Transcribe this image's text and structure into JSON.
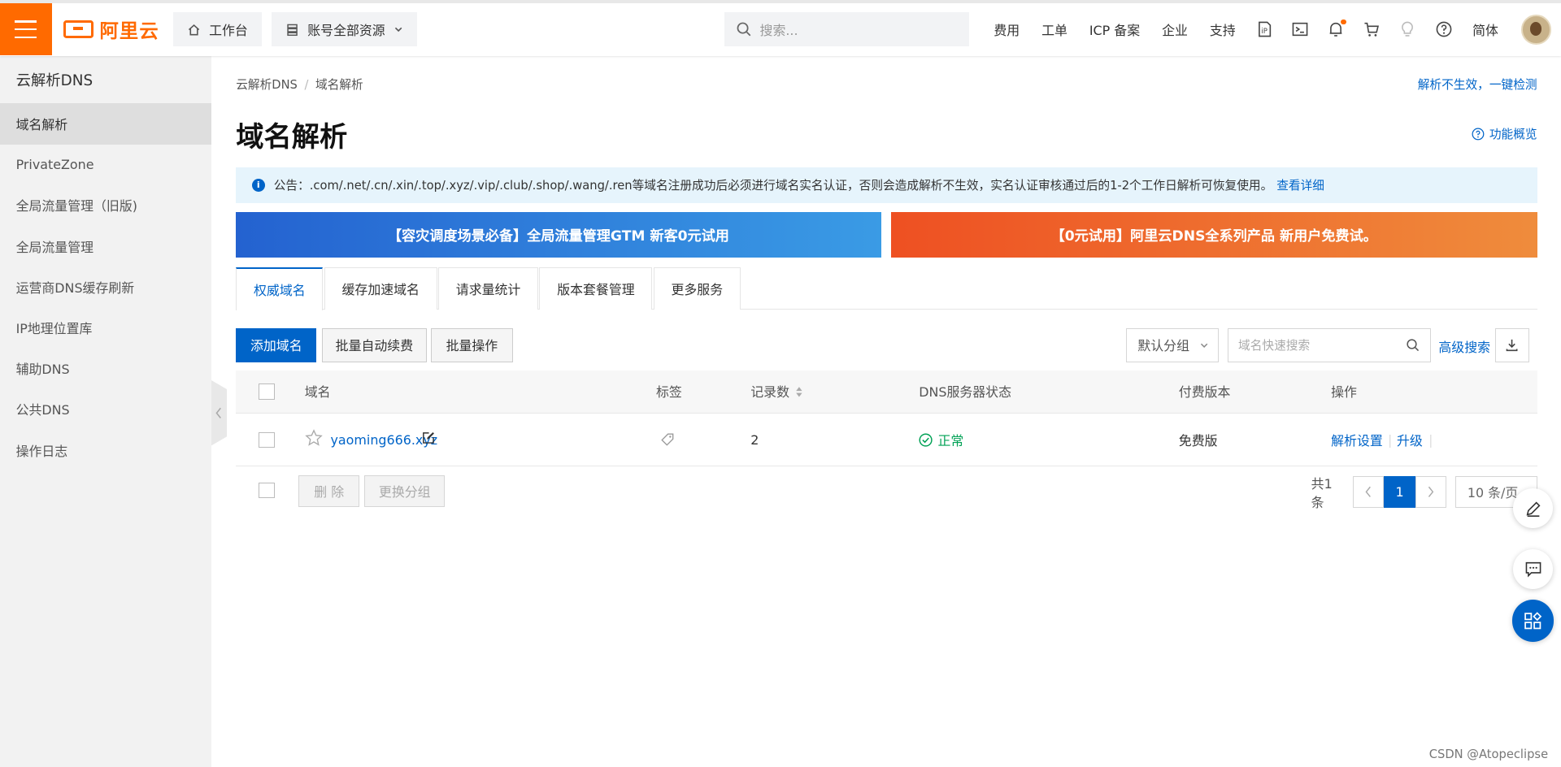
{
  "header": {
    "logo_text": "阿里云",
    "workbench_label": "工作台",
    "resource_label": "账号全部资源",
    "search_placeholder": "搜索...",
    "links": [
      "费用",
      "工单",
      "ICP 备案",
      "企业",
      "支持"
    ],
    "lang_label": "简体"
  },
  "sidebar": {
    "title": "云解析DNS",
    "items": [
      "域名解析",
      "PrivateZone",
      "全局流量管理（旧版)",
      "全局流量管理",
      "运营商DNS缓存刷新",
      "IP地理位置库",
      "辅助DNS",
      "公共DNS",
      "操作日志"
    ]
  },
  "breadcrumb": {
    "root": "云解析DNS",
    "sep": "/",
    "current": "域名解析"
  },
  "check_link": "解析不生效，一键检测",
  "page_title": "域名解析",
  "overview_label": "功能概览",
  "notice": {
    "text": "公告：.com/.net/.cn/.xin/.top/.xyz/.vip/.club/.shop/.wang/.ren等域名注册成功后必须进行域名实名认证，否则会造成解析不生效，实名认证审核通过后的1-2个工作日解析可恢复使用。",
    "link": "查看详细"
  },
  "banners": {
    "left": "【容灾调度场景必备】全局流量管理GTM 新客0元试用",
    "right": "【0元试用】阿里云DNS全系列产品 新用户免费试。"
  },
  "tabs": [
    "权威域名",
    "缓存加速域名",
    "请求量统计",
    "版本套餐管理",
    "更多服务"
  ],
  "toolbar": {
    "add": "添加域名",
    "auto_renew": "批量自动续费",
    "batch": "批量操作",
    "group": "默认分组",
    "search_placeholder": "域名快速搜索",
    "advanced": "高级搜索"
  },
  "table": {
    "headers": [
      "域名",
      "标签",
      "记录数",
      "DNS服务器状态",
      "付费版本",
      "操作"
    ],
    "rows": [
      {
        "domain": "yaoming666.xyz",
        "records": "2",
        "status": "正常",
        "plan": "免费版",
        "action1": "解析设置",
        "action2": "升级"
      }
    ]
  },
  "footer": {
    "delete": "删 除",
    "change_group": "更换分组",
    "total": "共1条",
    "page": "1",
    "page_size": "10 条/页"
  },
  "watermark": "CSDN @Atopeclipse",
  "colors": {
    "brand": "#ff6a00",
    "primary": "#0064c8",
    "success": "#00a155"
  }
}
